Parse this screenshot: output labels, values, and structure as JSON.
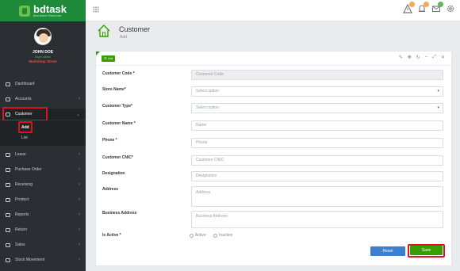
{
  "brand": {
    "name": "bdtask",
    "tagline": "Best Admin Panel ever"
  },
  "user": {
    "name": "JOHN DOE",
    "status": "Super Admin",
    "store": "Multishop Street"
  },
  "sidebar": {
    "items": [
      {
        "label": "Dashboard"
      },
      {
        "label": "Accounts",
        "chevron": "‹"
      },
      {
        "label": "Customer",
        "chevron": "⌄"
      },
      {
        "label": "Lease",
        "chevron": "‹"
      },
      {
        "label": "Puchase Order",
        "chevron": "‹"
      },
      {
        "label": "Receiving",
        "chevron": "‹"
      },
      {
        "label": "Product",
        "chevron": "‹"
      },
      {
        "label": "Reports",
        "chevron": "‹"
      },
      {
        "label": "Return",
        "chevron": "‹"
      },
      {
        "label": "Sales",
        "chevron": "‹"
      },
      {
        "label": "Stock Movement",
        "chevron": "‹"
      }
    ],
    "sub_items": [
      {
        "label": "Add"
      },
      {
        "label": "List"
      }
    ]
  },
  "topbar": {
    "icons": [
      "warning-icon",
      "bell-icon",
      "mail-icon",
      "gear-icon"
    ],
    "badge_colors": [
      "#f0ad4e",
      "#f0ad4e",
      "#5cb85c"
    ]
  },
  "header": {
    "title": "Customer",
    "subtitle": "Add"
  },
  "panel": {
    "list_button": "List",
    "tools": [
      "✎",
      "✥",
      "↻",
      "–",
      "⤢",
      "✕"
    ]
  },
  "form": {
    "customer_code": {
      "label": "Customer Code *",
      "placeholder": "Customer Code"
    },
    "store_name": {
      "label": "Store Name*",
      "value": "Select option"
    },
    "customer_type": {
      "label": "Customer Type*",
      "value": "Select option"
    },
    "customer_name": {
      "label": "Customer Name *",
      "placeholder": "Name"
    },
    "phone": {
      "label": "Phone *",
      "placeholder": "Phone"
    },
    "cnic": {
      "label": "Customer CNIC*",
      "placeholder": "Customer CNIC"
    },
    "designation": {
      "label": "Designation",
      "placeholder": "Designation"
    },
    "address": {
      "label": "Address",
      "placeholder": "Address"
    },
    "business_address": {
      "label": "Business Address",
      "placeholder": "Business Address"
    },
    "is_active": {
      "label": "Is Active *",
      "options": [
        "Active",
        "Inactive"
      ]
    }
  },
  "buttons": {
    "reset": "Reset",
    "save": "Save"
  },
  "colors": {
    "accent": "#37a000",
    "highlight": "#e0121b",
    "sidebar": "#2b2f33",
    "reset": "#3c7fd0"
  }
}
